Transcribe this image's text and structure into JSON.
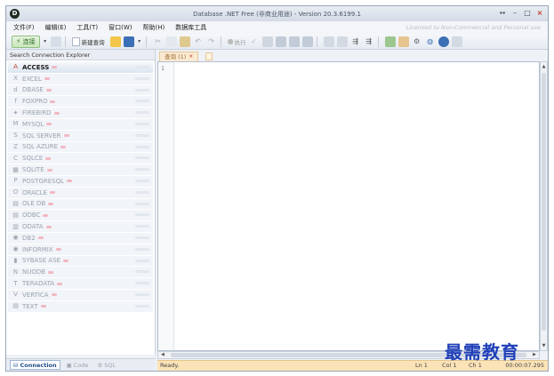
{
  "window": {
    "title": "Database .NET Free (非商业用途) - Version 20.3.6199.1",
    "logo_text": "D",
    "controls": [
      "↔",
      "–",
      "□",
      "×"
    ]
  },
  "menu": {
    "items": [
      "文件(F)",
      "编辑(E)",
      "工具(T)",
      "窗口(W)",
      "帮助(H)",
      "数据库工具"
    ],
    "license_text": "Licensed to Non-Commercial and Personal use"
  },
  "toolbar": {
    "connect_label": "连接",
    "new_query_label": "新建查询",
    "execute_label": "执行"
  },
  "left_panel": {
    "header": "Search Connection Explorer",
    "connections": [
      {
        "label": "ACCESS",
        "icon": "access-icon",
        "glyph": "A",
        "active": true
      },
      {
        "label": "EXCEL",
        "icon": "excel-icon",
        "glyph": "X",
        "active": false
      },
      {
        "label": "DBASE",
        "icon": "dbase-icon",
        "glyph": "d",
        "active": false
      },
      {
        "label": "FOXPRO",
        "icon": "foxpro-icon",
        "glyph": "f",
        "active": false
      },
      {
        "label": "FIREBIRD",
        "icon": "firebird-icon",
        "glyph": "✦",
        "active": false
      },
      {
        "label": "MYSQL",
        "icon": "mysql-icon",
        "glyph": "M",
        "active": false
      },
      {
        "label": "SQL SERVER",
        "icon": "sqlserver-icon",
        "glyph": "S",
        "active": false
      },
      {
        "label": "SQL AZURE",
        "icon": "sqlazure-icon",
        "glyph": "Z",
        "active": false
      },
      {
        "label": "SQLCE",
        "icon": "sqlce-icon",
        "glyph": "C",
        "active": false
      },
      {
        "label": "SQLITE",
        "icon": "sqlite-icon",
        "glyph": "▦",
        "active": false
      },
      {
        "label": "POSTGRESQL",
        "icon": "postgresql-icon",
        "glyph": "P",
        "active": false
      },
      {
        "label": "ORACLE",
        "icon": "oracle-icon",
        "glyph": "O",
        "active": false
      },
      {
        "label": "OLE DB",
        "icon": "oledb-icon",
        "glyph": "▤",
        "active": false
      },
      {
        "label": "ODBC",
        "icon": "odbc-icon",
        "glyph": "▤",
        "active": false
      },
      {
        "label": "ODATA",
        "icon": "odata-icon",
        "glyph": "▥",
        "active": false
      },
      {
        "label": "DB2",
        "icon": "db2-icon",
        "glyph": "◉",
        "active": false
      },
      {
        "label": "INFORMIX",
        "icon": "informix-icon",
        "glyph": "◉",
        "active": false
      },
      {
        "label": "SYBASE ASE",
        "icon": "sybase-icon",
        "glyph": "▮",
        "active": false
      },
      {
        "label": "NUODB",
        "icon": "nuodb-icon",
        "glyph": "N",
        "active": false
      },
      {
        "label": "TERADATA",
        "icon": "teradata-icon",
        "glyph": "T",
        "active": false
      },
      {
        "label": "VERTICA",
        "icon": "vertica-icon",
        "glyph": "V",
        "active": false
      },
      {
        "label": "TEXT",
        "icon": "text-icon",
        "glyph": "▤",
        "active": false
      }
    ]
  },
  "doc_tabs": [
    {
      "label": "查询 (1)",
      "close": "×"
    }
  ],
  "editor": {
    "line_numbers": [
      "1"
    ]
  },
  "bottom_tabs": [
    {
      "label": "Connection",
      "icon": "connection-icon",
      "glyph": "⛁",
      "active": true
    },
    {
      "label": "Code",
      "icon": "code-icon",
      "glyph": "▣",
      "active": false
    },
    {
      "label": "SQL",
      "icon": "sql-icon",
      "glyph": "⚙",
      "active": false
    }
  ],
  "status": {
    "ready": "Ready.",
    "ln": "Ln 1",
    "col": "Col 1",
    "ch": "Ch 1",
    "time": "00:00:07.295"
  },
  "watermark": "最需教育",
  "colors": {
    "accent": "#1f3fb8",
    "tab_bg": "#fbead2",
    "status_bg": "#fbe3b7",
    "active_connection": "#c0392b"
  }
}
